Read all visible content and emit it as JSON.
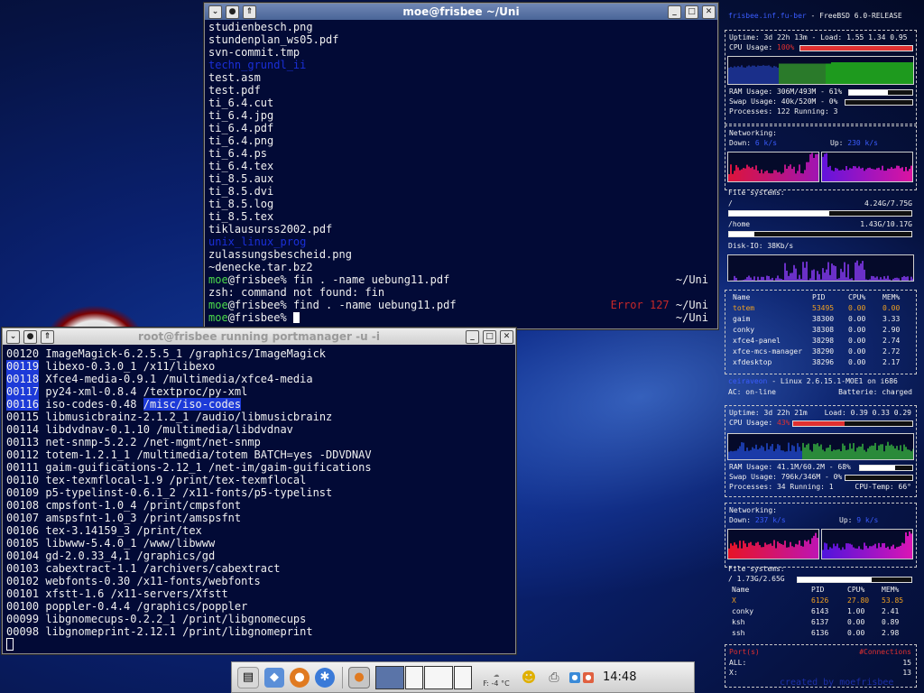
{
  "win1": {
    "title": "moe@frisbee ~/Uni",
    "lines": [
      {
        "t": "studienbesch.png"
      },
      {
        "t": "stundenplan_ws05.pdf"
      },
      {
        "t": "svn-commit.tmp"
      },
      {
        "t": "techn_grundl_ii",
        "cls": "dir"
      },
      {
        "t": "test.asm"
      },
      {
        "t": "test.pdf"
      },
      {
        "t": "ti_6.4.cut"
      },
      {
        "t": "ti_6.4.jpg"
      },
      {
        "t": "ti_6.4.pdf"
      },
      {
        "t": "ti_6.4.png"
      },
      {
        "t": "ti_6.4.ps"
      },
      {
        "t": "ti_6.4.tex"
      },
      {
        "t": "ti_8.5.aux"
      },
      {
        "t": "ti_8.5.dvi"
      },
      {
        "t": "ti_8.5.log"
      },
      {
        "t": "ti_8.5.tex"
      },
      {
        "t": "tiklausurss2002.pdf"
      },
      {
        "t": "unix_linux_prog",
        "cls": "dir"
      },
      {
        "t": "zulassungsbescheid.png"
      },
      {
        "t": "~denecke.tar.bz2"
      }
    ],
    "cmd1": {
      "user": "moe",
      "host": "@frisbee% ",
      "cmd": "fin . -name uebung11.pdf",
      "right": "~/Uni"
    },
    "error_line": "zsh: command not found: fin",
    "cmd2": {
      "user": "moe",
      "host": "@frisbee% ",
      "cmd": "find . -name uebung11.pdf",
      "err": "Error 127",
      "right": "~/Uni"
    },
    "cmd3": {
      "user": "moe",
      "host": "@frisbee% ",
      "right": "~/Uni"
    }
  },
  "win2": {
    "title": "root@frisbee running portmanager -u -i",
    "lines": [
      {
        "n": "00120",
        "p": "ImageMagick-6.2.5.5_1",
        "d": "/graphics/ImageMagick"
      },
      {
        "n": "00119",
        "p": "libexo-0.3.0_1",
        "d": "/x11/libexo"
      },
      {
        "n": "00118",
        "p": "Xfce4-media-0.9.1",
        "d": "/multimedia/xfce4-media"
      },
      {
        "n": "00117",
        "p": "py24-xml-0.8.4",
        "d": "/textproc/py-xml"
      },
      {
        "n": "00116",
        "p": "iso-codes-0.48",
        "d": "/misc/iso-codes"
      },
      {
        "n": "00115",
        "p": "libmusicbrainz-2.1.2_1",
        "d": "/audio/libmusicbrainz"
      },
      {
        "n": "00114",
        "p": "libdvdnav-0.1.10",
        "d": "/multimedia/libdvdnav"
      },
      {
        "n": "00113",
        "p": "net-snmp-5.2.2",
        "d": "/net-mgmt/net-snmp"
      },
      {
        "n": "00112",
        "p": "totem-1.2.1_1",
        "d": "/multimedia/totem BATCH=yes -DDVDNAV"
      },
      {
        "n": "00111",
        "p": "gaim-guifications-2.12_1",
        "d": "/net-im/gaim-guifications"
      },
      {
        "n": "00110",
        "p": "tex-texmflocal-1.9",
        "d": "/print/tex-texmflocal"
      },
      {
        "n": "00109",
        "p": "p5-typelinst-0.6.1_2",
        "d": "/x11-fonts/p5-typelinst"
      },
      {
        "n": "00108",
        "p": "cmpsfont-1.0_4",
        "d": "/print/cmpsfont"
      },
      {
        "n": "00107",
        "p": "amspsfnt-1.0_3",
        "d": "/print/amspsfnt"
      },
      {
        "n": "00106",
        "p": "tex-3.14159_3",
        "d": "/print/tex"
      },
      {
        "n": "00105",
        "p": "libwww-5.4.0_1",
        "d": "/www/libwww"
      },
      {
        "n": "00104",
        "p": "gd-2.0.33_4,1",
        "d": "/graphics/gd"
      },
      {
        "n": "00103",
        "p": "cabextract-1.1",
        "d": "/archivers/cabextract"
      },
      {
        "n": "00102",
        "p": "webfonts-0.30",
        "d": "/x11-fonts/webfonts"
      },
      {
        "n": "00101",
        "p": "xfstt-1.6",
        "d": "/x11-servers/Xfstt"
      },
      {
        "n": "00100",
        "p": "poppler-0.4.4",
        "d": "/graphics/poppler"
      },
      {
        "n": "00099",
        "p": "libgnomecups-0.2.2_1",
        "d": "/print/libgnomecups"
      },
      {
        "n": "00098",
        "p": "libgnomeprint-2.12.1",
        "d": "/print/libgnomeprint"
      }
    ]
  },
  "conky": {
    "top": {
      "host_label": "frisbee.inf.fu-ber",
      "os": "- FreeBSD 6.0-RELEASE",
      "uptime": "Uptime: 3d 22h 13m",
      "load": "- Load: 1.55 1.34 0.95",
      "cpu_label": "CPU Usage:",
      "cpu_val": "100%",
      "cpu_pct": 1.0,
      "ram": "RAM Usage: 306M/493M - 61%",
      "ram_pct": 0.61,
      "swap": "Swap Usage: 40k/520M - 0%",
      "swap_pct": 0.0,
      "procs": "Processes: 122  Running: 3",
      "net_label": "Networking:",
      "down_label": "Down:",
      "down_val": "6 k/s",
      "up_label": "Up:",
      "up_val": "230 k/s",
      "fs_label": "File systems:",
      "fs1_name": "/",
      "fs1_val": "4.24G/7.75G",
      "fs1_pct": 0.55,
      "fs2_name": "/home",
      "fs2_val": "1.43G/10.17G",
      "fs2_pct": 0.14,
      "diskio": "Disk-IO:  38Kb/s",
      "table_head": [
        "Name",
        "PID",
        "CPU%",
        "MEM%"
      ],
      "table": [
        [
          "totem",
          "53495",
          "0.00",
          "0.00"
        ],
        [
          "gaim",
          "38300",
          "0.00",
          "3.33"
        ],
        [
          "conky",
          "38308",
          "0.00",
          "2.90"
        ],
        [
          "xfce4-panel",
          "38298",
          "0.00",
          "2.74"
        ],
        [
          "xfce-mcs-manager",
          "38290",
          "0.00",
          "2.72"
        ],
        [
          "xfdesktop",
          "38296",
          "0.00",
          "2.17"
        ]
      ]
    },
    "bottom": {
      "host_label": "ceiraveon",
      "os": "- Linux 2.6.15.1-MOE1 on i686",
      "ac": "AC: on-line",
      "battery": "Batterie: charged",
      "uptime": "Uptime: 3d 22h 21m",
      "load": "Load: 0.39 0.33 0.29",
      "cpu_label": "CPU Usage:",
      "cpu_val": "43%",
      "cpu_pct": 0.43,
      "ram": "RAM Usage: 41.1M/60.2M - 68%",
      "ram_pct": 0.68,
      "swap": "Swap Usage: 796k/346M - 0%",
      "swap_pct": 0.0,
      "procs": "Processes: 34  Running: 1",
      "temp": "CPU-Temp: 66°",
      "net_label": "Networking:",
      "down_label": "Down:",
      "down_val": "237 k/s",
      "up_label": "Up:",
      "up_val": "9 k/s",
      "fs_label": "File systems:",
      "fs1": "/ 1.73G/2.65G",
      "fs1_pct": 0.65,
      "table_head": [
        "Name",
        "PID",
        "CPU%",
        "MEM%"
      ],
      "table": [
        [
          "X",
          "6126",
          "27.80",
          "53.85"
        ],
        [
          "conky",
          "6143",
          "1.00",
          "2.41"
        ],
        [
          "ksh",
          "6137",
          "0.00",
          "0.89"
        ],
        [
          "ssh",
          "6136",
          "0.00",
          "2.98"
        ]
      ],
      "ports_label": "Port(s)",
      "conn_label": "#Connections",
      "all_label": "ALL:",
      "all_val": "15",
      "x_label": "X:",
      "x_val": "13",
      "credit": "created by moefrisbee"
    }
  },
  "taskbar": {
    "temp": "F: -4 °C",
    "clock": "14:48"
  },
  "colors": {
    "accent_blue": "#1d3ad8",
    "prompt_green": "#4bd94b",
    "error_red": "#c82828",
    "conky_red": "#e03030",
    "conky_orange": "#f0a020"
  }
}
